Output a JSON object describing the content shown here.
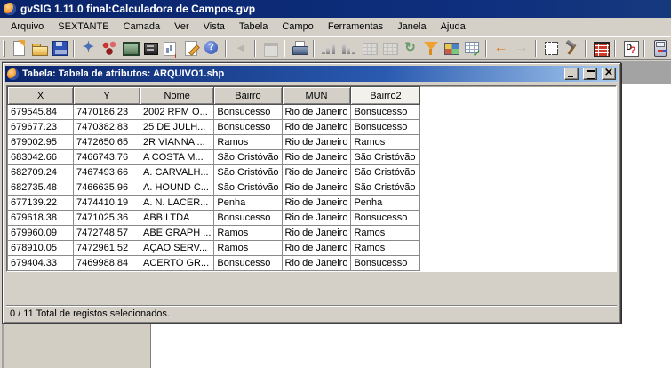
{
  "titlebar": {
    "title": "gvSIG 1.11.0 final:Calculadora de Campos.gvp"
  },
  "menubar": {
    "items": [
      "Arquivo",
      "SEXTANTE",
      "Camada",
      "Ver",
      "Vista",
      "Tabela",
      "Campo",
      "Ferramentas",
      "Janela",
      "Ajuda"
    ]
  },
  "toolbar": {
    "groups": [
      {
        "icons": [
          {
            "name": "new-document",
            "glyph": ""
          },
          {
            "name": "open-project",
            "glyph": ""
          },
          {
            "name": "save-project",
            "glyph": ""
          }
        ]
      },
      {
        "icons": [
          {
            "name": "sextante-toolbox",
            "glyph": "✦"
          },
          {
            "name": "sextante-models",
            "glyph": ""
          },
          {
            "name": "sextante-console",
            "glyph": ""
          },
          {
            "name": "sextante-history",
            "glyph": ""
          },
          {
            "name": "sextante-results",
            "glyph": ""
          },
          {
            "name": "sextante-notes",
            "glyph": ""
          },
          {
            "name": "help",
            "glyph": "?"
          }
        ]
      },
      {
        "icons": [
          {
            "name": "flip",
            "glyph": "◄",
            "disabled": true
          }
        ]
      },
      {
        "icons": [
          {
            "name": "window",
            "glyph": "",
            "disabled": true
          }
        ]
      },
      {
        "icons": [
          {
            "name": "print",
            "glyph": ""
          }
        ]
      },
      {
        "icons": [
          {
            "name": "sort-ascending",
            "glyph": ""
          },
          {
            "name": "sort-descending",
            "glyph": ""
          },
          {
            "name": "table-join",
            "glyph": "",
            "disabled": true
          },
          {
            "name": "table-link",
            "glyph": "",
            "disabled": true
          },
          {
            "name": "refresh",
            "glyph": "↻"
          },
          {
            "name": "filter",
            "glyph": ""
          },
          {
            "name": "statistics-table",
            "glyph": ""
          },
          {
            "name": "table-check",
            "glyph": ""
          }
        ]
      },
      {
        "icons": [
          {
            "name": "back-arrow",
            "glyph": "←"
          },
          {
            "name": "forward-arrow",
            "glyph": "→",
            "disabled": true
          }
        ]
      },
      {
        "icons": [
          {
            "name": "selection-tools",
            "glyph": ""
          },
          {
            "name": "preferences-tools",
            "glyph": ""
          }
        ]
      },
      {
        "icons": [
          {
            "name": "attributes-table",
            "glyph": ""
          }
        ]
      },
      {
        "icons": [
          {
            "name": "field-manager",
            "glyph": ""
          }
        ]
      },
      {
        "icons": [
          {
            "name": "field-calculator",
            "glyph": ""
          }
        ]
      }
    ]
  },
  "table_window": {
    "title": "Tabela: Tabela de atributos: ARQUIVO1.shp",
    "window_buttons": [
      "minimize",
      "maximize",
      "close"
    ],
    "columns": [
      "X",
      "Y",
      "Nome",
      "Bairro",
      "MUN",
      "Bairro2"
    ],
    "selected_column": "Bairro2",
    "rows": [
      [
        "679545.84",
        "7470186.23",
        "2002 RPM O...",
        "Bonsucesso",
        "Rio de Janeiro",
        "Bonsucesso"
      ],
      [
        "679677.23",
        "7470382.83",
        "25 DE JULH...",
        "Bonsucesso",
        "Rio de Janeiro",
        "Bonsucesso"
      ],
      [
        "679002.95",
        "7472650.65",
        "2R VIANNA ...",
        "Ramos",
        "Rio de Janeiro",
        "Ramos"
      ],
      [
        "683042.66",
        "7466743.76",
        "A COSTA M...",
        "São Cristóvão",
        "Rio de Janeiro",
        "São Cristóvão"
      ],
      [
        "682709.24",
        "7467493.66",
        "A. CARVALH...",
        "São Cristóvão",
        "Rio de Janeiro",
        "São Cristóvão"
      ],
      [
        "682735.48",
        "7466635.96",
        "A. HOUND C...",
        "São Cristóvão",
        "Rio de Janeiro",
        "São Cristóvão"
      ],
      [
        "677139.22",
        "7474410.19",
        "A. N. LACER...",
        "Penha",
        "Rio de Janeiro",
        "Penha"
      ],
      [
        "679618.38",
        "7471025.36",
        "ABB LTDA",
        "Bonsucesso",
        "Rio de Janeiro",
        "Bonsucesso"
      ],
      [
        "679960.09",
        "7472748.57",
        "ABE GRAPH ...",
        "Ramos",
        "Rio de Janeiro",
        "Ramos"
      ],
      [
        "678910.05",
        "7472961.52",
        "AÇAO SERV...",
        "Ramos",
        "Rio de Janeiro",
        "Ramos"
      ],
      [
        "679404.33",
        "7469988.84",
        "ACERTO GR...",
        "Bonsucesso",
        "Rio de Janeiro",
        "Bonsucesso"
      ]
    ],
    "status": "0 / 11 Total de registos selecionados."
  },
  "colors": {
    "titlebar_dark": "#0a246a",
    "titlebar_light": "#a6caf0",
    "window_face": "#d4d0c8",
    "mdi_background": "#a3a3a3",
    "toc_panel": "#d3cec3",
    "filter_accent": "#f0a030",
    "selected_header_bg": "#f2f1eb"
  }
}
